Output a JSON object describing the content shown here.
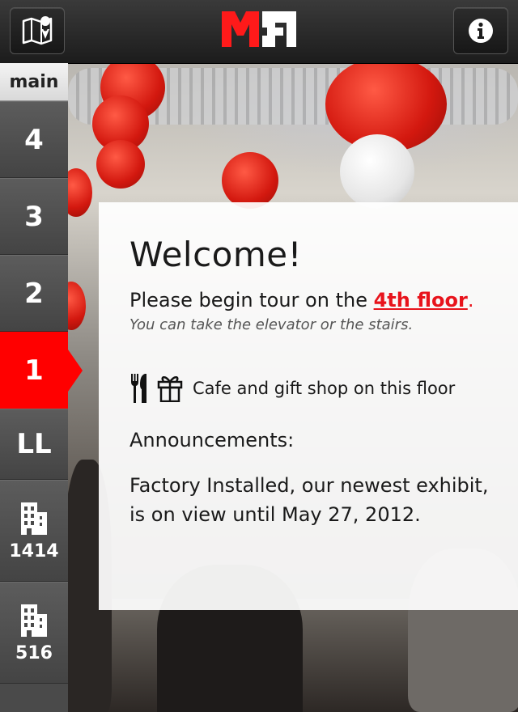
{
  "header": {
    "map_button_icon": "map-pin-icon",
    "logo_text": "MF",
    "info_button_icon": "info-icon"
  },
  "sidebar": {
    "main_label": "main",
    "floors": [
      {
        "label": "4",
        "active": false
      },
      {
        "label": "3",
        "active": false
      },
      {
        "label": "2",
        "active": false
      },
      {
        "label": "1",
        "active": true
      },
      {
        "label": "LL",
        "active": false
      }
    ],
    "buildings": [
      {
        "label": "1414",
        "icon": "building-icon"
      },
      {
        "label": "516",
        "icon": "building-icon"
      }
    ]
  },
  "card": {
    "title": "Welcome!",
    "begin_prefix": "Please begin tour on the ",
    "begin_link": "4th floor",
    "begin_suffix": ".",
    "subtitle": "You can take the elevator or the stairs.",
    "amenities_text": "Cafe and gift shop on this floor",
    "announcements_title": "Announcements:",
    "announcement": "Factory Installed, our newest exhibit, is on view until May 27, 2012."
  },
  "colors": {
    "accent_red": "#ff0000",
    "link_red": "#e8141c",
    "sidebar_gray": "#4a4a4a"
  }
}
